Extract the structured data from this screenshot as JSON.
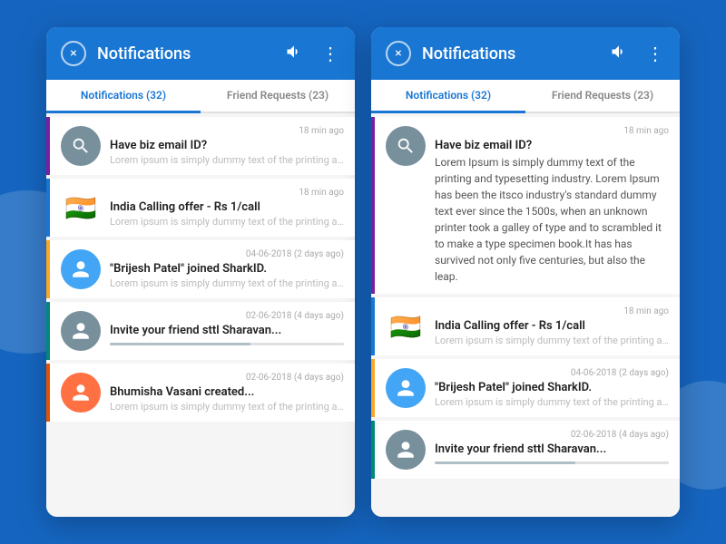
{
  "panels": [
    {
      "id": "panel-left",
      "header": {
        "title": "Notifications",
        "close_label": "×",
        "sound_icon": "🔊",
        "menu_icon": "⋮"
      },
      "tabs": [
        {
          "label": "Notifications (32)",
          "active": true
        },
        {
          "label": "Friend Requests (23)",
          "active": false
        }
      ],
      "notifications": [
        {
          "id": "notif-1",
          "color": "purple",
          "avatar_type": "search",
          "avatar_emoji": "🔍",
          "title": "Have biz email ID?",
          "time": "18 min ago",
          "body": "Lorem ipsum is simply dummy text of the printing and",
          "expanded": false
        },
        {
          "id": "notif-2",
          "color": "blue",
          "avatar_type": "flag",
          "avatar_emoji": "🇮🇳",
          "title": "India Calling offer - Rs 1/call",
          "time": "18 min ago",
          "body": "Lorem ipsum is simply dummy text of the printing and",
          "expanded": false
        },
        {
          "id": "notif-3",
          "color": "yellow",
          "avatar_type": "person1",
          "avatar_emoji": "👤",
          "title": "\"Brijesh Patel\" joined SharkID.",
          "time": "04-06-2018 (2 days ago)",
          "body": "Lorem ipsum is simply dummy text of the printing and",
          "expanded": false
        },
        {
          "id": "notif-4",
          "color": "teal",
          "avatar_type": "person2",
          "avatar_emoji": "👤",
          "title": "Invite your friend sttl Sharavan...",
          "time": "02-06-2018 (4 days ago)",
          "body": "",
          "expanded": false,
          "has_progress": true,
          "progress_color": "#B0BEC5",
          "progress_pct": 60
        },
        {
          "id": "notif-5",
          "color": "orange",
          "avatar_type": "person3",
          "avatar_emoji": "👤",
          "title": "Bhumisha Vasani created...",
          "time": "02-06-2018 (4 days ago)",
          "body": "Lorem ipsum is simply dummy text of the printing and",
          "expanded": false
        }
      ]
    },
    {
      "id": "panel-right",
      "header": {
        "title": "Notifications",
        "close_label": "×",
        "sound_icon": "🔊",
        "menu_icon": "⋮"
      },
      "tabs": [
        {
          "label": "Notifications (32)",
          "active": true
        },
        {
          "label": "Friend Requests (23)",
          "active": false
        }
      ],
      "notifications": [
        {
          "id": "notif-r1",
          "color": "purple",
          "avatar_type": "search",
          "avatar_emoji": "🔍",
          "title": "Have biz email ID?",
          "time": "18 min ago",
          "body": "Lorem Ipsum is simply dummy text of the printing and typesetting industry. Lorem Ipsum has been the itsco industry's standard dummy text ever since the 1500s, when an unknown printer took a galley of type and to scrambled it to make a type specimen book.It has has survived not only five centuries, but also the leap.",
          "expanded": true
        },
        {
          "id": "notif-r2",
          "color": "blue",
          "avatar_type": "flag",
          "avatar_emoji": "🇮🇳",
          "title": "India Calling offer - Rs 1/call",
          "time": "18 min ago",
          "body": "Lorem ipsum is simply dummy text of the printing and",
          "expanded": false
        },
        {
          "id": "notif-r3",
          "color": "yellow",
          "avatar_type": "person1",
          "avatar_emoji": "👤",
          "title": "\"Brijesh Patel\" joined SharkID.",
          "time": "04-06-2018 (2 days ago)",
          "body": "Lorem ipsum is simply dummy text of the printing and",
          "expanded": false
        },
        {
          "id": "notif-r4",
          "color": "teal",
          "avatar_type": "person2",
          "avatar_emoji": "👤",
          "title": "Invite your friend sttl Sharavan...",
          "time": "02-06-2018 (4 days ago)",
          "body": "",
          "expanded": false,
          "has_progress": true,
          "progress_color": "#B0BEC5",
          "progress_pct": 60
        }
      ]
    }
  ],
  "colors": {
    "header_bg": "#1976D2",
    "active_tab": "#1976D2",
    "purple": "#7B1FA2",
    "blue": "#1976D2",
    "yellow": "#F9A825",
    "teal": "#00897B",
    "orange": "#E65100"
  }
}
